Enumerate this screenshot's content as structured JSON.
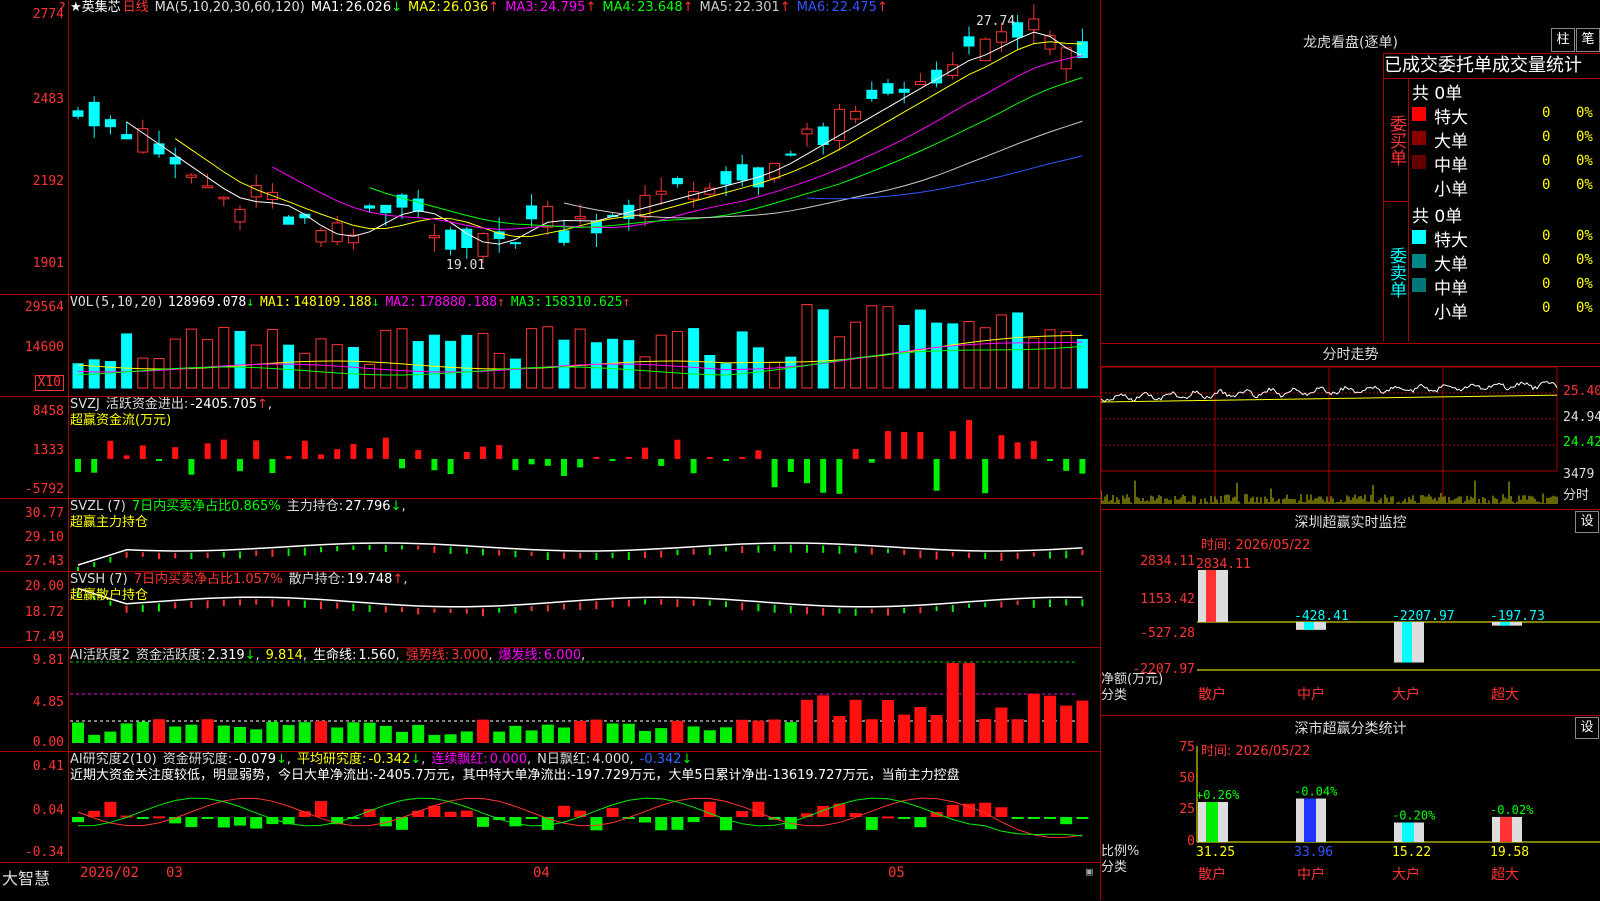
{
  "app": {
    "logo": "大智慧",
    "corner": "?"
  },
  "kline": {
    "stock": "★英集芯",
    "period": "日线",
    "ma_label": "MA(5,10,20,30,60,120)",
    "ma": [
      {
        "name": "MA1:",
        "val": "26.026",
        "arrow": "↓",
        "color": "#ffffff"
      },
      {
        "name": "MA2:",
        "val": "26.036",
        "arrow": "↑",
        "color": "#ffff00"
      },
      {
        "name": "MA3:",
        "val": "24.795",
        "arrow": "↑",
        "color": "#ff00ff"
      },
      {
        "name": "MA4:",
        "val": "23.648",
        "arrow": "↑",
        "color": "#00ff00"
      },
      {
        "name": "MA5:",
        "val": "22.301",
        "arrow": "↑",
        "color": "#cccccc"
      },
      {
        "name": "MA6:",
        "val": "22.475",
        "arrow": "↑",
        "color": "#3355ff"
      }
    ],
    "axis": [
      "2774",
      "2483",
      "2192",
      "1901"
    ],
    "high_label": "27.74",
    "low_label": "19.01"
  },
  "vol": {
    "label": "VOL(5,10,20)",
    "v": "128969.078",
    "v_arrow": "↓",
    "ma": [
      {
        "name": "MA1:",
        "val": "148109.188",
        "arrow": "↓",
        "color": "#ffff00"
      },
      {
        "name": "MA2:",
        "val": "178880.188",
        "arrow": "↑",
        "color": "#ff00ff"
      },
      {
        "name": "MA3:",
        "val": "158310.625",
        "arrow": "↑",
        "color": "#00ff00"
      }
    ],
    "axis": [
      "29564",
      "14600"
    ],
    "unit": "X10"
  },
  "svzj": {
    "label": "SVZJ",
    "name": "活跃资金进出:",
    "val": "-2405.705",
    "arrow": "↑",
    "comma": ",",
    "sub": "超赢资金流(万元)",
    "axis": [
      "8458",
      "1333",
      "-5792"
    ]
  },
  "svzl": {
    "label": "SVZL (7)",
    "text1": "7日内买卖净占比0.865%",
    "name": "主力持仓:",
    "val": "27.796",
    "arrow": "↓",
    "comma": ",",
    "sub": "超赢主力持仓",
    "axis": [
      "30.77",
      "29.10",
      "27.43"
    ]
  },
  "svsh": {
    "label": "SVSH (7)",
    "text1": "7日内买卖净占比1.057%",
    "name": "散户持仓:",
    "val": "19.748",
    "arrow": "↑",
    "comma": ",",
    "sub": "超赢散户持仓",
    "axis": [
      "20.00",
      "18.72",
      "17.49"
    ]
  },
  "ai1": {
    "label": "AI活跃度2",
    "name": "资金活跃度:",
    "val": "2.319",
    "arrow": "↓",
    "comma": ",",
    "v2": "9.814",
    "comma2": ",",
    "life": "生命线:",
    "life_v": "1.560",
    "comma3": ",",
    "strong": "强势线:",
    "strong_v": "3.000",
    "comma4": ",",
    "burst": "爆发线:",
    "burst_v": "6.000",
    "comma5": ",",
    "axis": [
      "9.81",
      "4.85",
      "0.00"
    ]
  },
  "ai2": {
    "label": "AI研究度2(10)",
    "name": "资金研究度:",
    "val": "-0.079",
    "arrow": "↓",
    "comma": ",",
    "avg": "平均研究度:",
    "avg_v": "-0.342",
    "arrow2": "↓",
    "comma2": ",",
    "red": "连续飘红:",
    "red_v": "0.000",
    "comma3": ",",
    "nred": "N日飘红:",
    "nred_v": "4.000",
    "comma4": ",",
    "last": "-0.342",
    "arrow3": "↓",
    "desc": "近期大资金关注度较低，明显弱势，今日大单净流出:-2405.7万元，其中特大单净流出:-197.729万元，大单5日累计净出-13619.727万元，当前主力控盘",
    "axis": [
      "0.41",
      "0.04",
      "-0.34"
    ]
  },
  "dates": [
    "2026/02",
    "03",
    "04",
    "05"
  ],
  "lhb": {
    "title": "龙虎看盘(逐单)",
    "btn1": "柱",
    "btn2": "笔",
    "tabs": "已成交委托单成交量统计",
    "buy": {
      "side": "委买单",
      "total": "共 0单",
      "rows": [
        {
          "name": "特大",
          "v": "0",
          "p": "0%",
          "color": "#ff0000"
        },
        {
          "name": "大单",
          "v": "0",
          "p": "0%",
          "color": "#880000"
        },
        {
          "name": "中单",
          "v": "0",
          "p": "0%",
          "color": "#660000"
        },
        {
          "name": "小单",
          "v": "0",
          "p": "0%",
          "color": "#000000"
        }
      ]
    },
    "sell": {
      "side": "委卖单",
      "total": "共 0单",
      "rows": [
        {
          "name": "特大",
          "v": "0",
          "p": "0%",
          "color": "#00ffff"
        },
        {
          "name": "大单",
          "v": "0",
          "p": "0%",
          "color": "#008888"
        },
        {
          "name": "中单",
          "v": "0",
          "p": "0%",
          "color": "#007777"
        },
        {
          "name": "小单",
          "v": "0",
          "p": "0%",
          "color": "#000000"
        }
      ]
    }
  },
  "fenshi": {
    "title": "分时走势",
    "axis": [
      "25.40",
      "24.94",
      "24.42",
      "3479"
    ],
    "unit": "分时"
  },
  "sz_monitor": {
    "title": "深圳超赢实时监控",
    "btn": "设",
    "time": "时间: 2026/05/22",
    "axis": [
      "2834.11",
      "1153.42",
      "-527.28",
      "-2207.97"
    ],
    "unit": "净额(万元)",
    "cat_label": "分类",
    "cats": [
      "散户",
      "中户",
      "大户",
      "超大"
    ],
    "values": [
      "2834.11",
      "-428.41",
      "-2207.97",
      "-197.73"
    ]
  },
  "sz_class": {
    "title": "深市超赢分类统计",
    "btn": "设",
    "time": "时间: 2026/05/22",
    "axis": [
      "75",
      "50",
      "25",
      "0"
    ],
    "unit": "比例%",
    "cat_label": "分类",
    "cats": [
      "散户",
      "中户",
      "大户",
      "超大"
    ],
    "pct": [
      "31.25",
      "33.96",
      "15.22",
      "19.58"
    ],
    "chg": [
      "+0.26%",
      "-0.04%",
      "-0.20%",
      "-0.02%"
    ]
  }
}
